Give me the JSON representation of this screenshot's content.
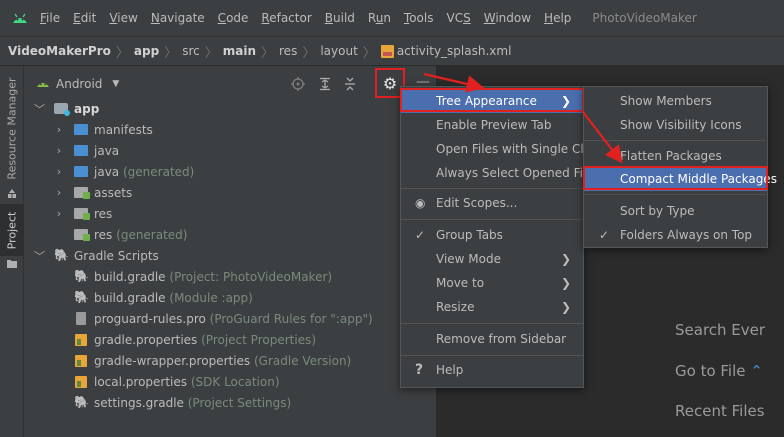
{
  "menubar": {
    "items": [
      {
        "label": "File",
        "u": "F",
        "rest": "ile"
      },
      {
        "label": "Edit",
        "u": "E",
        "rest": "dit"
      },
      {
        "label": "View",
        "u": "V",
        "rest": "iew"
      },
      {
        "label": "Navigate",
        "u": "N",
        "rest": "avigate"
      },
      {
        "label": "Code",
        "u": "C",
        "rest": "ode"
      },
      {
        "label": "Refactor",
        "u": "R",
        "rest": "efactor"
      },
      {
        "label": "Build",
        "u": "B",
        "rest": "uild"
      },
      {
        "label": "Run",
        "pre": "R",
        "u": "u",
        "rest": "n"
      },
      {
        "label": "Tools",
        "u": "T",
        "rest": "ools"
      },
      {
        "label": "VCS",
        "pre": "VC",
        "u": "S",
        "rest": ""
      },
      {
        "label": "Window",
        "u": "W",
        "rest": "indow"
      },
      {
        "label": "Help",
        "u": "H",
        "rest": "elp"
      }
    ],
    "project_name": "PhotoVideoMaker"
  },
  "breadcrumb": {
    "items": [
      "VideoMakerPro",
      "app",
      "src",
      "main",
      "res",
      "layout",
      "activity_splash.xml"
    ]
  },
  "toolstrip": {
    "resource_manager": "Resource Manager",
    "project": "Project"
  },
  "panel": {
    "view_name": "Android"
  },
  "tree": {
    "app": "app",
    "manifests": "manifests",
    "java": "java",
    "java_gen": "java",
    "java_gen_hint": "(generated)",
    "assets": "assets",
    "res": "res",
    "res_gen": "res",
    "res_gen_hint": "(generated)",
    "gradle_scripts": "Gradle Scripts",
    "build_gradle_project": "build.gradle",
    "build_gradle_project_hint": "(Project: PhotoVideoMaker)",
    "build_gradle_module": "build.gradle",
    "build_gradle_module_hint": "(Module :app)",
    "proguard": "proguard-rules.pro",
    "proguard_hint": "(ProGuard Rules for \":app\")",
    "gradle_properties": "gradle.properties",
    "gradle_properties_hint": "(Project Properties)",
    "gradle_wrapper": "gradle-wrapper.properties",
    "gradle_wrapper_hint": "(Gradle Version)",
    "local_properties": "local.properties",
    "local_properties_hint": "(SDK Location)",
    "settings_gradle": "settings.gradle",
    "settings_gradle_hint": "(Project Settings)"
  },
  "editor": {
    "search_everywhere": "Search Ever",
    "go_to_file": "Go to File",
    "recent_files": "Recent Files"
  },
  "menu": {
    "tree_appearance": "Tree Appearance",
    "enable_preview_tab": "Enable Preview Tab",
    "open_single_click": "Open Files with Single Click",
    "always_select_opened": "Always Select Opened File",
    "edit_scopes": "Edit Scopes...",
    "group_tabs": "Group Tabs",
    "view_mode": "View Mode",
    "move_to": "Move to",
    "resize": "Resize",
    "remove_from_sidebar": "Remove from Sidebar",
    "help": "Help"
  },
  "submenu": {
    "show_members": "Show Members",
    "show_visibility_icons": "Show Visibility Icons",
    "flatten_packages": "Flatten Packages",
    "compact_middle_packages": "Compact Middle Packages",
    "sort_by_type": "Sort by Type",
    "folders_always_on_top": "Folders Always on Top"
  },
  "colors": {
    "menu_bg": "#3c3f41",
    "editor_bg": "#2b2b2b",
    "selection": "#4b6eaf",
    "annotation_red": "#e0211f",
    "folder_blue": "#4a8fd1"
  }
}
